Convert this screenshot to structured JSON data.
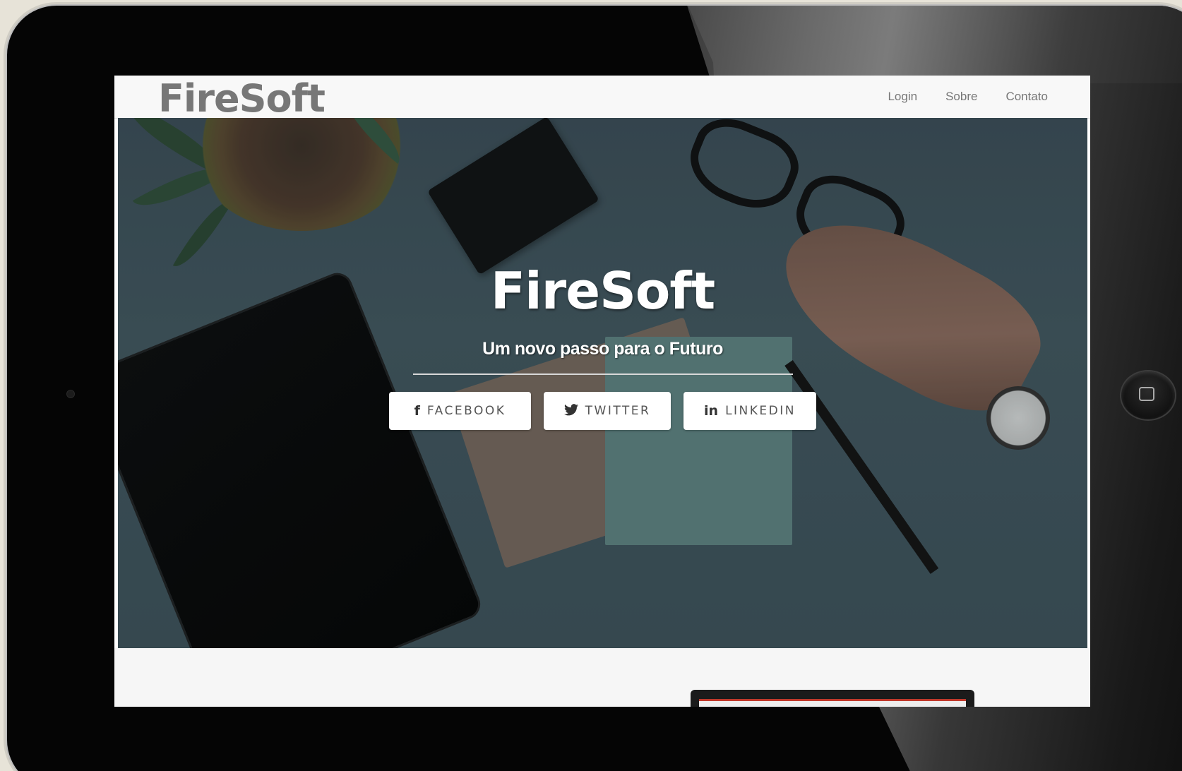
{
  "navbar": {
    "brand": "FireSoft",
    "links": [
      "Login",
      "Sobre",
      "Contato"
    ]
  },
  "hero": {
    "title": "FireSoft",
    "subtitle": "Um novo passo para o Futuro",
    "buttons": [
      {
        "icon": "facebook-icon",
        "glyph": "f",
        "label": "FACEBOOK"
      },
      {
        "icon": "twitter-icon",
        "glyph": "🐦",
        "label": "TWITTER"
      },
      {
        "icon": "linkedin-icon",
        "glyph": "in",
        "label": "LINKEDIN"
      }
    ]
  },
  "colors": {
    "navbar_bg": "#f8f8f8",
    "brand_text": "#777777",
    "hero_text": "#ffffff",
    "button_bg": "#ffffff",
    "device_frame": "#050505"
  }
}
